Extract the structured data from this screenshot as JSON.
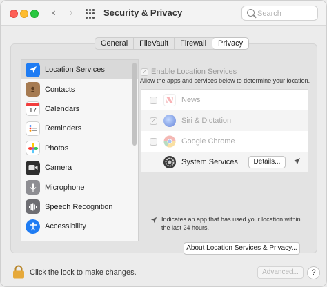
{
  "window": {
    "title": "Security & Privacy"
  },
  "toolbar": {
    "back_icon": "chevron-left-icon",
    "forward_icon": "chevron-right-icon",
    "show_all_icon": "grid-icon",
    "search_placeholder": "Search"
  },
  "tabs": [
    {
      "label": "General",
      "active": false
    },
    {
      "label": "FileVault",
      "active": false
    },
    {
      "label": "Firewall",
      "active": false
    },
    {
      "label": "Privacy",
      "active": true
    }
  ],
  "sidebar": {
    "items": [
      {
        "label": "Location Services",
        "icon": "location-arrow-icon",
        "color": "#1f7cf3",
        "selected": true
      },
      {
        "label": "Contacts",
        "icon": "contacts-book-icon",
        "color": "#a67b52",
        "selected": false
      },
      {
        "label": "Calendars",
        "icon": "calendar-icon",
        "color": "#ffffff",
        "selected": false
      },
      {
        "label": "Reminders",
        "icon": "reminders-list-icon",
        "color": "#ffffff",
        "selected": false
      },
      {
        "label": "Photos",
        "icon": "photos-flower-icon",
        "color": "#ffffff",
        "selected": false
      },
      {
        "label": "Camera",
        "icon": "camera-icon",
        "color": "#2f2f2f",
        "selected": false
      },
      {
        "label": "Microphone",
        "icon": "microphone-icon",
        "color": "#8e8e93",
        "selected": false
      },
      {
        "label": "Speech Recognition",
        "icon": "waveform-icon",
        "color": "#6e6e73",
        "selected": false
      },
      {
        "label": "Accessibility",
        "icon": "accessibility-icon",
        "color": "#1f7cf3",
        "selected": false
      }
    ],
    "calendar_day": "17"
  },
  "location": {
    "enable_label": "Enable Location Services",
    "enable_checked": true,
    "description": "Allow the apps and services below to determine your location.",
    "apps": [
      {
        "name": "News",
        "checked": false,
        "icon": "news-icon",
        "enabled": false
      },
      {
        "name": "Siri & Dictation",
        "checked": true,
        "icon": "siri-icon",
        "enabled": false
      },
      {
        "name": "Google Chrome",
        "checked": false,
        "icon": "chrome-icon",
        "enabled": false
      },
      {
        "name": "System Services",
        "checked": false,
        "icon": "system-services-gear-icon",
        "enabled": true
      }
    ],
    "details_button": "Details...",
    "legend_text": "Indicates an app that has used your location within the last 24 hours.",
    "about_button": "About Location Services & Privacy..."
  },
  "footer": {
    "lock_text": "Click the lock to make changes.",
    "advanced_button": "Advanced...",
    "help_button": "?"
  }
}
